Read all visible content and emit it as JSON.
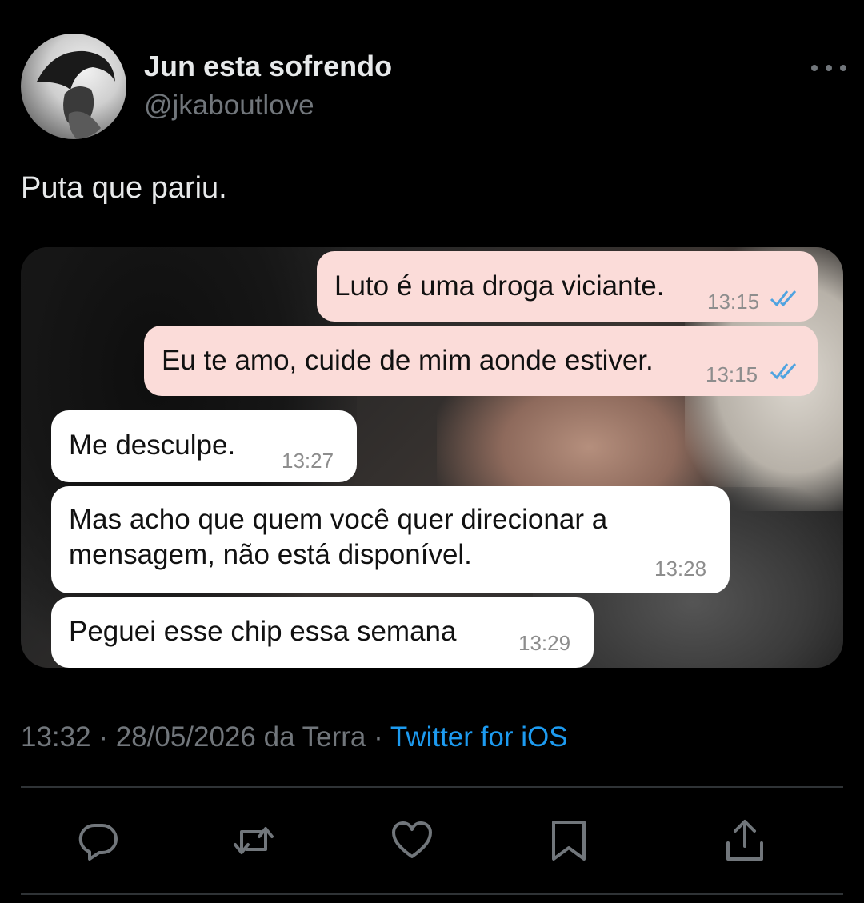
{
  "user": {
    "display_name": "Jun esta sofrendo",
    "handle": "@jkaboutlove"
  },
  "tweet": {
    "text": "Puta que pariu."
  },
  "chat": {
    "messages": [
      {
        "direction": "out",
        "text": "Luto é uma droga viciante.",
        "time": "13:15",
        "status": "read"
      },
      {
        "direction": "out",
        "text": "Eu te amo, cuide de mim aonde estiver.",
        "time": "13:15",
        "status": "read"
      },
      {
        "direction": "in",
        "text": "Me desculpe.",
        "time": "13:27"
      },
      {
        "direction": "in",
        "lines": [
          "Mas acho que quem você quer direcionar a",
          "mensagem, não está disponível."
        ],
        "time": "13:28"
      },
      {
        "direction": "in",
        "text": "Peguei esse chip essa semana",
        "time": "13:29"
      }
    ]
  },
  "meta": {
    "time": "13:32",
    "sep1": " · ",
    "date": "28/05/2026",
    "location": " da Terra",
    "sep2": " · ",
    "source": "Twitter for iOS"
  },
  "actions": [
    {
      "name": "reply",
      "icon": "reply-icon"
    },
    {
      "name": "retweet",
      "icon": "retweet-icon"
    },
    {
      "name": "like",
      "icon": "heart-icon"
    },
    {
      "name": "bookmark",
      "icon": "bookmark-icon"
    },
    {
      "name": "share",
      "icon": "share-icon"
    }
  ],
  "colors": {
    "background": "#000000",
    "link": "#1d9bf0",
    "muted": "#71767b",
    "outgoing_bubble": "#fbdcd9",
    "incoming_bubble": "#ffffff",
    "read_ticks": "#4fa3e0"
  }
}
